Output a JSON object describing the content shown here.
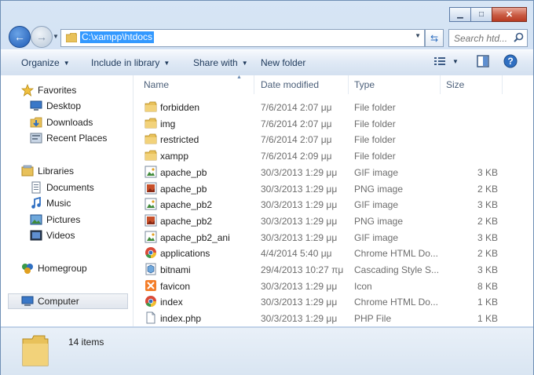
{
  "window": {
    "caption": {
      "minimize": "▁",
      "maximize": "□",
      "close": "✕"
    }
  },
  "address_bar": {
    "path": "C:\\xampp\\htdocs"
  },
  "search": {
    "placeholder": "Search htd..."
  },
  "toolbar": {
    "organize": "Organize",
    "include_in_library": "Include in library",
    "share_with": "Share with",
    "new_folder": "New folder",
    "help": "?"
  },
  "sidebar": {
    "favorites": {
      "label": "Favorites",
      "items": [
        {
          "label": "Desktop",
          "icon": "desktop-icon"
        },
        {
          "label": "Downloads",
          "icon": "downloads-icon"
        },
        {
          "label": "Recent Places",
          "icon": "recent-places-icon"
        }
      ]
    },
    "libraries": {
      "label": "Libraries",
      "items": [
        {
          "label": "Documents",
          "icon": "documents-icon"
        },
        {
          "label": "Music",
          "icon": "music-icon"
        },
        {
          "label": "Pictures",
          "icon": "pictures-icon"
        },
        {
          "label": "Videos",
          "icon": "videos-icon"
        }
      ]
    },
    "homegroup": {
      "label": "Homegroup"
    },
    "computer": {
      "label": "Computer",
      "selected": true
    }
  },
  "columns": {
    "name": "Name",
    "date": "Date modified",
    "type": "Type",
    "size": "Size"
  },
  "files": [
    {
      "name": "forbidden",
      "date": "7/6/2014 2:07 μμ",
      "type": "File folder",
      "size": "",
      "icon": "folder-icon"
    },
    {
      "name": "img",
      "date": "7/6/2014 2:07 μμ",
      "type": "File folder",
      "size": "",
      "icon": "folder-icon"
    },
    {
      "name": "restricted",
      "date": "7/6/2014 2:07 μμ",
      "type": "File folder",
      "size": "",
      "icon": "folder-icon"
    },
    {
      "name": "xampp",
      "date": "7/6/2014 2:09 μμ",
      "type": "File folder",
      "size": "",
      "icon": "folder-icon"
    },
    {
      "name": "apache_pb",
      "date": "30/3/2013 1:29 μμ",
      "type": "GIF image",
      "size": "3 KB",
      "icon": "gif-image-icon"
    },
    {
      "name": "apache_pb",
      "date": "30/3/2013 1:29 μμ",
      "type": "PNG image",
      "size": "2 KB",
      "icon": "png-image-icon"
    },
    {
      "name": "apache_pb2",
      "date": "30/3/2013 1:29 μμ",
      "type": "GIF image",
      "size": "3 KB",
      "icon": "gif-image-icon"
    },
    {
      "name": "apache_pb2",
      "date": "30/3/2013 1:29 μμ",
      "type": "PNG image",
      "size": "2 KB",
      "icon": "png-image-icon"
    },
    {
      "name": "apache_pb2_ani",
      "date": "30/3/2013 1:29 μμ",
      "type": "GIF image",
      "size": "3 KB",
      "icon": "gif-image-icon"
    },
    {
      "name": "applications",
      "date": "4/4/2014 5:40 μμ",
      "type": "Chrome HTML Do...",
      "size": "2 KB",
      "icon": "chrome-icon"
    },
    {
      "name": "bitnami",
      "date": "29/4/2013 10:27 πμ",
      "type": "Cascading Style S...",
      "size": "3 KB",
      "icon": "css-file-icon"
    },
    {
      "name": "favicon",
      "date": "30/3/2013 1:29 μμ",
      "type": "Icon",
      "size": "8 KB",
      "icon": "xampp-icon"
    },
    {
      "name": "index",
      "date": "30/3/2013 1:29 μμ",
      "type": "Chrome HTML Do...",
      "size": "1 KB",
      "icon": "chrome-icon"
    },
    {
      "name": "index.php",
      "date": "30/3/2013 1:29 μμ",
      "type": "PHP File",
      "size": "1 KB",
      "icon": "php-file-icon"
    }
  ],
  "details": {
    "count": "14 items"
  },
  "colors": {
    "selection": "#3399ff",
    "folder": "#e8c15a",
    "header_text": "#4c607a",
    "muted_text": "#6d6d6d"
  }
}
